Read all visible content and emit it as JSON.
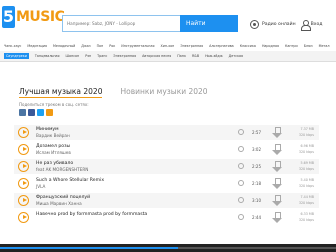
{
  "header": {
    "logo_digit": "5",
    "logo_text": "MUSIC",
    "search_placeholder": "Например: Sabz, JONY - Lollipop",
    "search_button": "Найти",
    "radio_label": "Радио онлайн",
    "login_label": "Вход"
  },
  "genres": {
    "row1": [
      "Чанк-хаус",
      "Медитация",
      "Мелодичный",
      "Джаз",
      "Поп",
      "Рок",
      "Инструментальная",
      "Хип-хоп",
      "Электронная",
      "Альтернатива",
      "Классика",
      "Народная",
      "Кантри",
      "Блюз",
      "Метал"
    ],
    "row2": [
      "Саундтреки",
      "Танцевальная",
      "Шансон",
      "Рэп",
      "Транс",
      "Электронная",
      "Авторская песня",
      "Панк",
      "R&B",
      "Нью-эйдж",
      "Детская"
    ],
    "active_row2_index": 0
  },
  "tabs": [
    {
      "label": "Лучшая музыка 2020",
      "active": true
    },
    {
      "label": "Новинки музыки 2020",
      "active": false
    }
  ],
  "share_label": "Поделиться треком в соц. сетях:",
  "social": [
    {
      "icon": "vk-icon",
      "color": "#4c75a3"
    },
    {
      "icon": "facebook-icon",
      "color": "#3b5998"
    },
    {
      "icon": "twitter-icon",
      "color": "#1da1f2"
    },
    {
      "icon": "ok-icon",
      "color": "#f19a13"
    }
  ],
  "tracks": [
    {
      "title": "Минимум",
      "artist": "Вардик Вейран",
      "duration": "2:57",
      "size": "7.37 MB",
      "bitrate": "320 kbps"
    },
    {
      "title": "Дозамел розы",
      "artist": "Ислам Итляшев",
      "duration": "3:02",
      "size": "6.96 MB",
      "bitrate": "320 kbps"
    },
    {
      "title": "Не раз убивало",
      "artist": "feat AK MORGENSHTERN",
      "duration": "2:25",
      "size": "5.69 MB",
      "bitrate": "320 kbps"
    },
    {
      "title": "Such a Whore Stellular Remix",
      "artist": "JVLA",
      "duration": "2:18",
      "size": "5.40 MB",
      "bitrate": "320 kbps"
    },
    {
      "title": "Французский поцелуй",
      "artist": "Миша Марвин Ханна",
      "duration": "3:10",
      "size": "7.44 MB",
      "bitrate": "320 kbps"
    },
    {
      "title": "Навечно prod by formmasta prod by formmasta",
      "artist": "",
      "duration": "2:44",
      "size": "6.33 MB",
      "bitrate": "320 kbps"
    }
  ],
  "player_progress": 0.53,
  "colors": {
    "accent": "#1d90f0",
    "brand_orange": "#f19a13"
  }
}
